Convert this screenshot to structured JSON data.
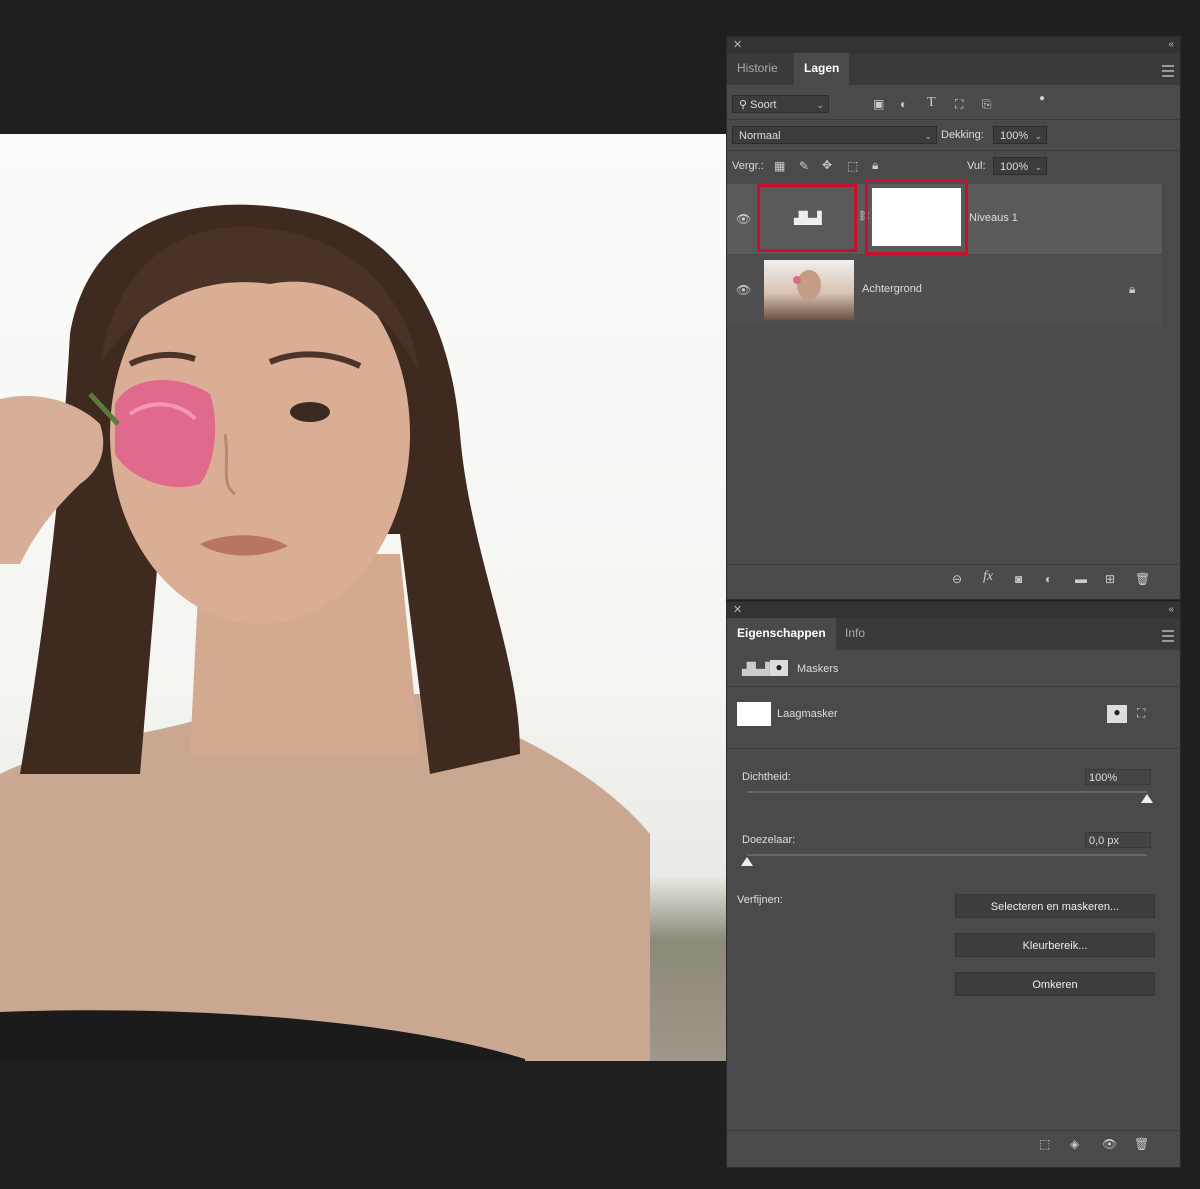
{
  "layers_panel": {
    "tabs": [
      "Historie",
      "Lagen"
    ],
    "filter": {
      "label": "Soort"
    },
    "blend_mode": "Normaal",
    "opacity": {
      "label": "Dekking:",
      "value": "100%"
    },
    "lock": {
      "label": "Vergr.:"
    },
    "fill": {
      "label": "Vul:",
      "value": "100%"
    },
    "layers": [
      {
        "name": "Niveaus 1",
        "visible": true,
        "selected": true
      },
      {
        "name": "Achtergrond",
        "visible": true,
        "locked": true
      }
    ]
  },
  "properties_panel": {
    "tabs": [
      "Eigenschappen",
      "Info"
    ],
    "section_title": "Maskers",
    "mask_label": "Laagmasker",
    "density": {
      "label": "Dichtheid:",
      "value": "100%",
      "level": 1.0
    },
    "feather": {
      "label": "Doezelaar:",
      "value": "0,0 px",
      "level": 0.0
    },
    "refine_label": "Verfijnen:",
    "buttons": {
      "select_and_mask": "Selecteren en maskeren...",
      "color_range": "Kleurbereik...",
      "invert": "Omkeren"
    }
  },
  "colors": {
    "highlight": "#c8102e",
    "panel": "#4a4a4a",
    "background": "#1f1f1f"
  }
}
